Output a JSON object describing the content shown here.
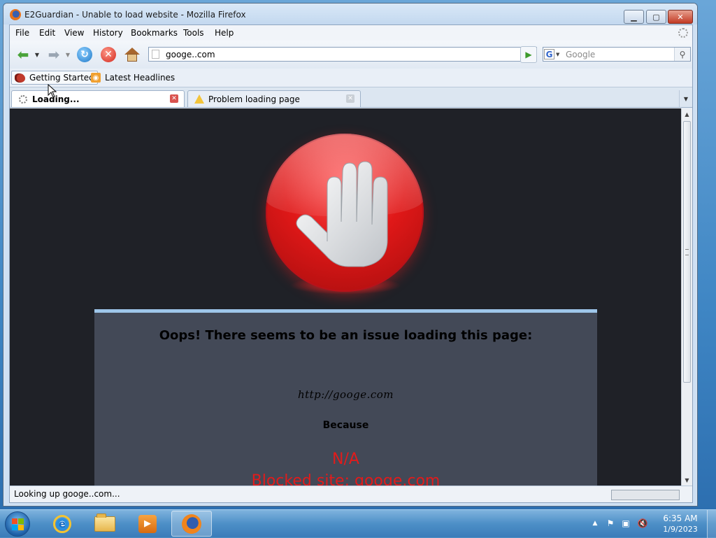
{
  "window": {
    "title": "E2Guardian - Unable to load website - Mozilla Firefox",
    "minimize_icon": "minimize-icon",
    "maximize_icon": "maximize-icon",
    "close_icon": "close-icon"
  },
  "menu": {
    "items": [
      "File",
      "Edit",
      "View",
      "History",
      "Bookmarks",
      "Tools",
      "Help"
    ]
  },
  "navigation": {
    "url": "googe..com",
    "search_placeholder": "Google",
    "search_engine": "G"
  },
  "bookmarks": {
    "items": [
      "Getting Started",
      "Latest Headlines"
    ]
  },
  "tabs": [
    {
      "label": "Loading...",
      "active": true
    },
    {
      "label": "Problem loading page",
      "active": false
    }
  ],
  "page": {
    "heading": "Oops! There seems to be an issue loading this page:",
    "url": "http://googe.com",
    "because": "Because",
    "reason_code": "N/A",
    "reason": "Blocked site: googe.com"
  },
  "status": {
    "text": "Looking up googe..com..."
  },
  "taskbar": {
    "clock_time": "6:35 AM",
    "clock_date": "1/9/2023"
  },
  "colors": {
    "accent_red": "#e21b1b",
    "page_background": "#1f2127",
    "panel_background": "#434957",
    "panel_top_border": "#9ec6ea"
  }
}
